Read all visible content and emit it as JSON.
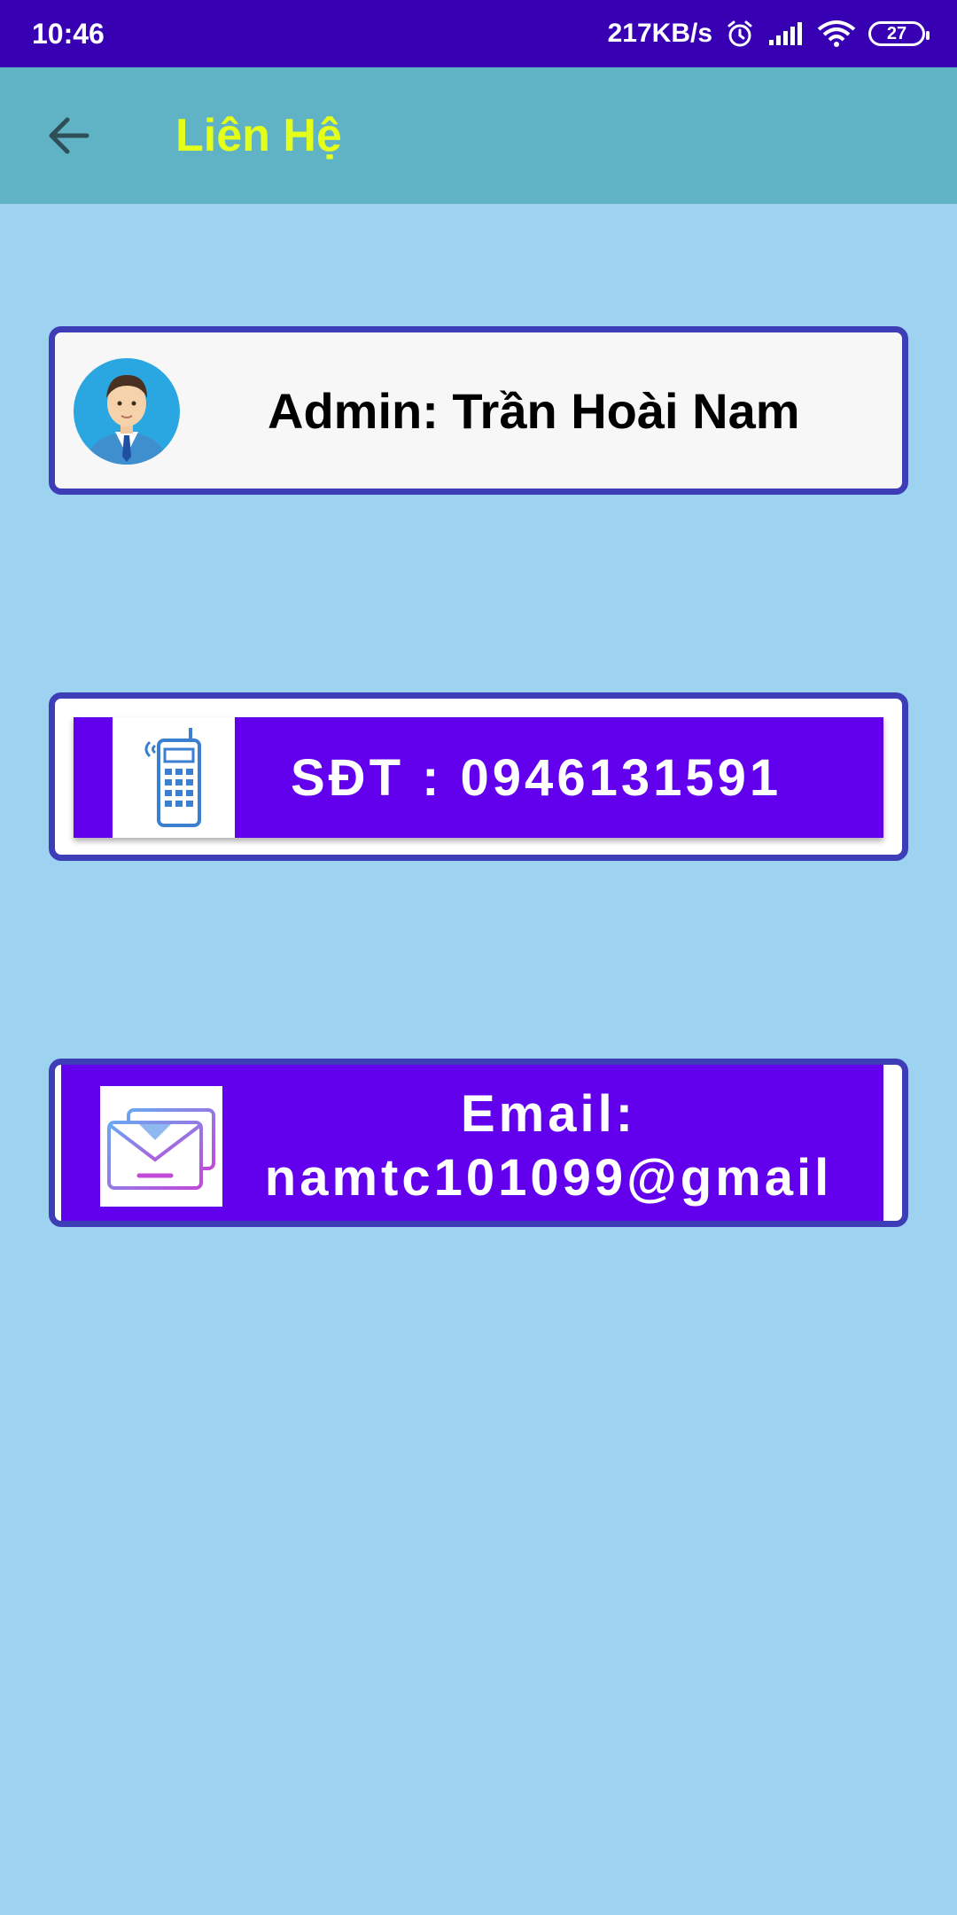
{
  "status_bar": {
    "time": "10:46",
    "network_speed": "217KB/s",
    "battery": "27",
    "icons": [
      "alarm-icon",
      "signal-icon",
      "wifi-icon",
      "battery-icon"
    ]
  },
  "app_bar": {
    "title": "Liên Hệ",
    "back_icon": "arrow-back-icon",
    "background_color": "#60b3c4",
    "title_color": "#e4ff1a"
  },
  "contacts": {
    "admin": {
      "text": "Admin: Trần Hoài Nam",
      "icon": "admin-avatar-icon"
    },
    "phone": {
      "text": "SĐT : 0946131591",
      "icon": "phone-icon"
    },
    "email": {
      "label": "Email:",
      "value": "namtc101099@gmail",
      "icon": "envelope-icon"
    }
  },
  "colors": {
    "status_bar": "#3700b3",
    "page_background": "#9dd3f0",
    "card_border": "#3d3db8",
    "button_fill": "#6200ee"
  }
}
